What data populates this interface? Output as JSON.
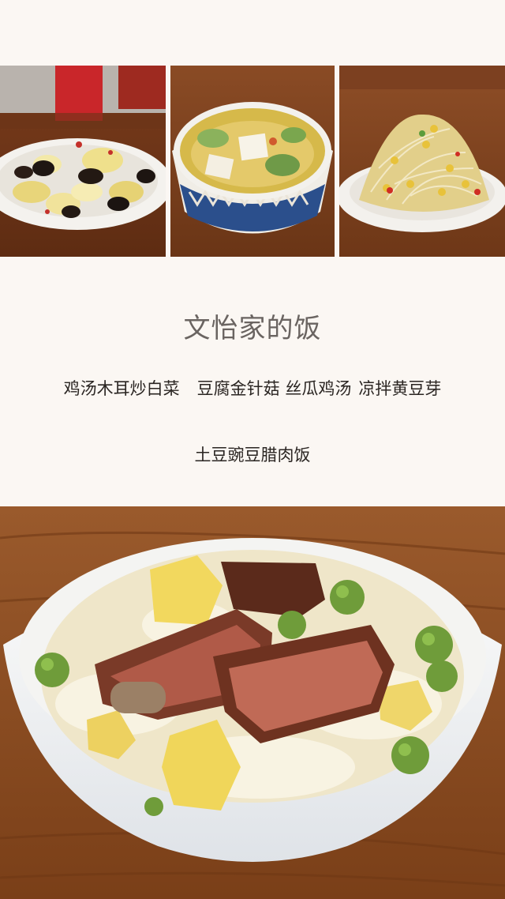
{
  "title": "文怡家的饭",
  "dishes": [
    "鸡汤木耳炒白菜",
    "豆腐金针菇 丝瓜鸡汤",
    "凉拌黄豆芽"
  ],
  "main_dish": "土豆豌豆腊肉饭",
  "photos": [
    {
      "name": "cabbage-wood-ear-photo"
    },
    {
      "name": "tofu-soup-photo"
    },
    {
      "name": "soybean-sprouts-photo"
    },
    {
      "name": "potato-pea-cured-pork-rice-photo"
    }
  ]
}
